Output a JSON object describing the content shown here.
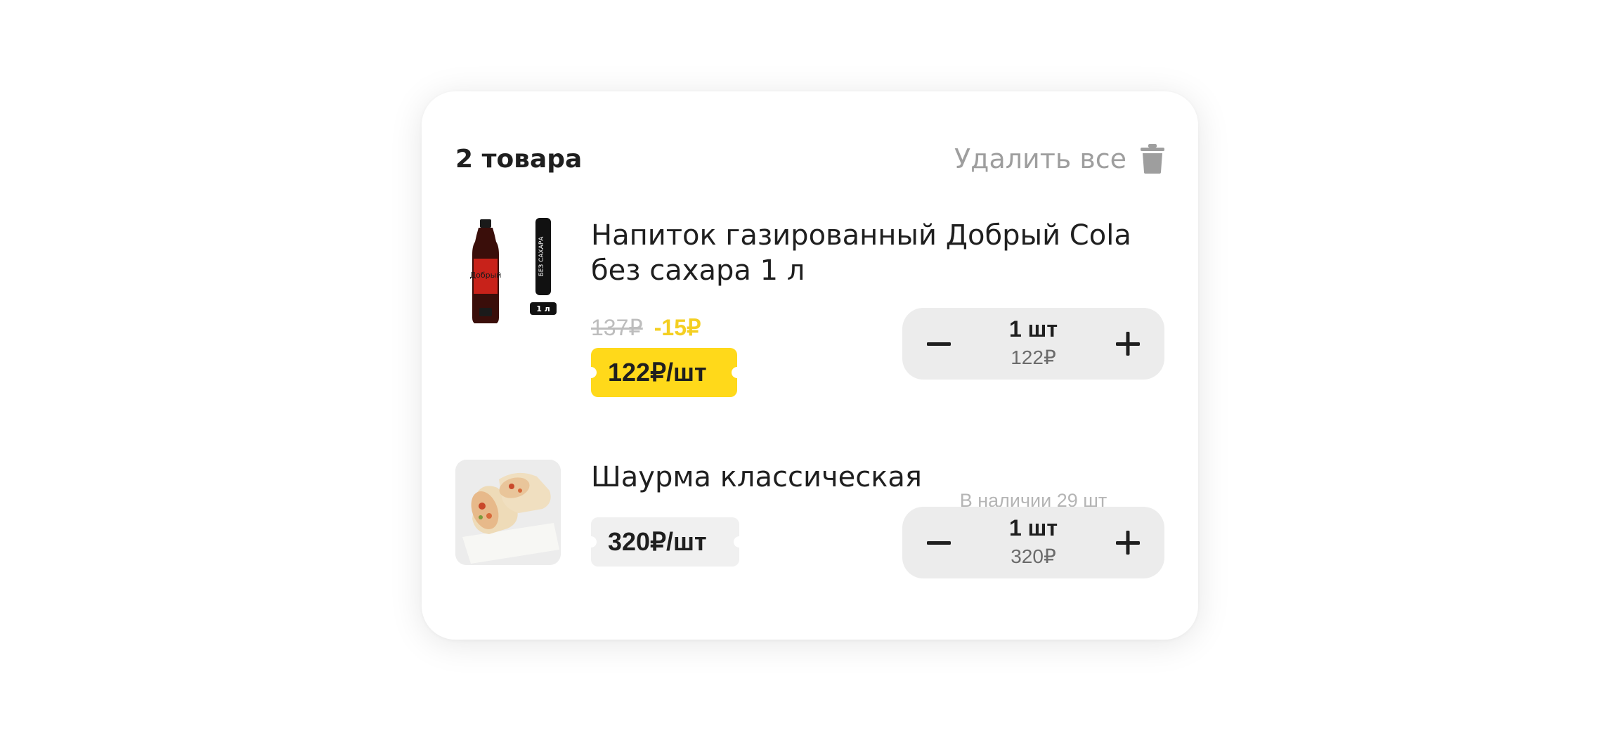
{
  "cart": {
    "count_label": "2 товара",
    "delete_all_label": "Удалить все"
  },
  "items": [
    {
      "name": "Напиток газированный Добрый Cola без сахара 1 л",
      "old_price": "137₽",
      "discount": "-15₽",
      "unit_price": "122₽/шт",
      "quantity": "1 шт",
      "total": "122₽",
      "stock": "В наличии 29 шт",
      "image_label_top": "БЕЗ САХАРА",
      "image_label_volume": "1 л",
      "image_brand": "Добрый"
    },
    {
      "name": "Шаурма классическая",
      "unit_price": "320₽/шт",
      "quantity": "1 шт",
      "total": "320₽"
    }
  ],
  "colors": {
    "accent_yellow": "#ffd91a",
    "discount_text": "#f4cf22",
    "muted_text": "#9e9e9e",
    "stepper_bg": "#ececec"
  },
  "icons": [
    "trash-icon",
    "minus-icon",
    "plus-icon"
  ]
}
